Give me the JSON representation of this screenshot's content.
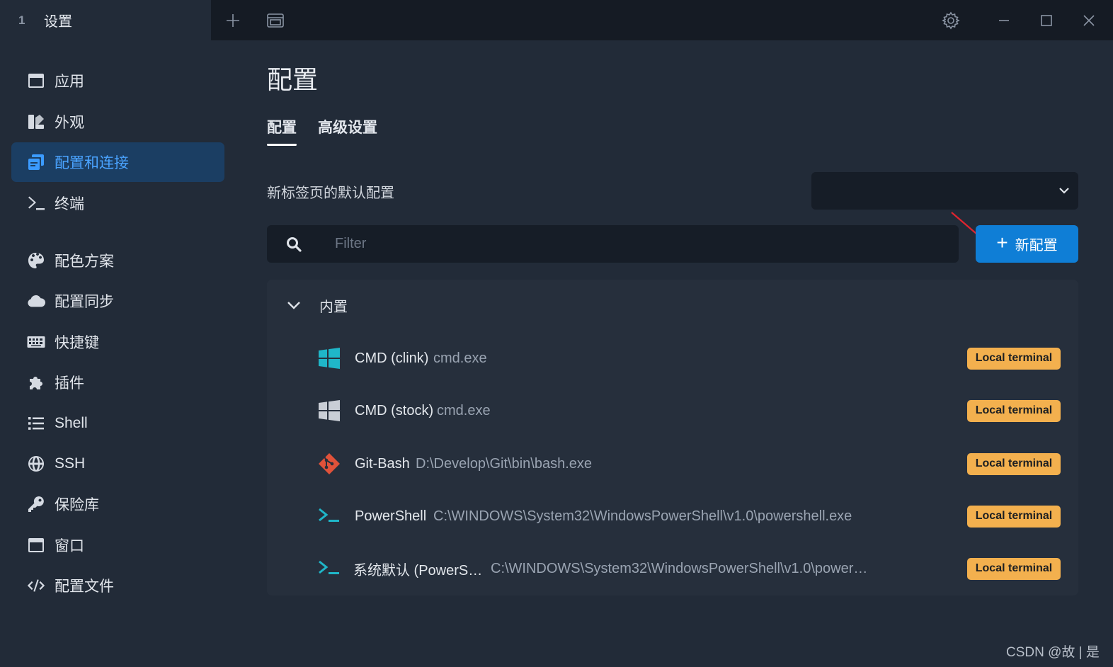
{
  "titlebar": {
    "tab_number": "1",
    "tab_title": "设置",
    "icons": [
      "plus-icon",
      "window-icon",
      "gear-icon",
      "minimize-icon",
      "maximize-icon",
      "close-icon"
    ]
  },
  "sidebar": {
    "items": [
      {
        "label": "应用",
        "icon": "app-window-icon",
        "active": false
      },
      {
        "label": "外观",
        "icon": "appearance-icon",
        "active": false
      },
      {
        "label": "配置和连接",
        "icon": "profiles-icon",
        "active": true
      },
      {
        "label": "终端",
        "icon": "terminal-prompt-icon",
        "active": false
      },
      {
        "label": "配色方案",
        "icon": "palette-icon",
        "active": false
      },
      {
        "label": "配置同步",
        "icon": "cloud-icon",
        "active": false
      },
      {
        "label": "快捷键",
        "icon": "keyboard-icon",
        "active": false
      },
      {
        "label": "插件",
        "icon": "puzzle-icon",
        "active": false
      },
      {
        "label": "Shell",
        "icon": "list-icon",
        "active": false
      },
      {
        "label": "SSH",
        "icon": "globe-icon",
        "active": false
      },
      {
        "label": "保险库",
        "icon": "key-icon",
        "active": false
      },
      {
        "label": "窗口",
        "icon": "window-icon",
        "active": false
      },
      {
        "label": "配置文件",
        "icon": "code-icon",
        "active": false
      }
    ]
  },
  "main": {
    "title": "配置",
    "tabs": [
      {
        "label": "配置",
        "active": true
      },
      {
        "label": "高级设置",
        "active": false
      }
    ],
    "default_profile_label": "新标签页的默认配置",
    "default_profile_value": "",
    "filter_placeholder": "Filter",
    "new_button_label": "新配置",
    "group": {
      "label": "内置",
      "profiles": [
        {
          "name": "CMD (clink)",
          "command": "cmd.exe",
          "badge": "Local terminal",
          "icon": "windows-color-icon"
        },
        {
          "name": "CMD (stock)",
          "command": "cmd.exe",
          "badge": "Local terminal",
          "icon": "windows-gray-icon"
        },
        {
          "name": "Git-Bash",
          "command": "D:\\Develop\\Git\\bin\\bash.exe",
          "badge": "Local terminal",
          "icon": "git-icon"
        },
        {
          "name": "PowerShell",
          "command": "C:\\WINDOWS\\System32\\WindowsPowerShell\\v1.0\\powershell.exe",
          "badge": "Local terminal",
          "icon": "powershell-icon"
        },
        {
          "name": "系统默认 (PowerS…",
          "command": "C:\\WINDOWS\\System32\\WindowsPowerShell\\v1.0\\power…",
          "badge": "Local terminal",
          "icon": "powershell-icon"
        }
      ]
    }
  },
  "colors": {
    "accent": "#0f7ed6",
    "active_nav_bg": "#1b3e63",
    "badge": "#f3b04e",
    "teal_icon": "#1fb6c8"
  },
  "watermark": "CSDN @故 | 是"
}
